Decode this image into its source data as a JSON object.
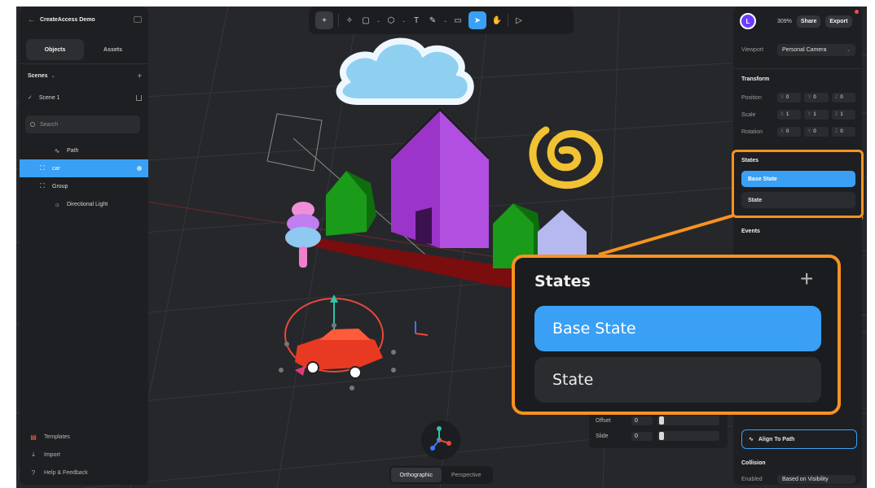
{
  "project": {
    "title": "CreateAccess Demo"
  },
  "left_panel": {
    "tabs": [
      {
        "label": "Objects"
      },
      {
        "label": "Assets"
      }
    ],
    "scenes_label": "Scenes",
    "scene_name": "Scene 1",
    "search_placeholder": "Search",
    "tree": [
      {
        "label": "Path",
        "icon": "path-icon"
      },
      {
        "label": "car",
        "icon": "group-icon",
        "selected": true
      },
      {
        "label": "Group",
        "icon": "group-icon"
      },
      {
        "label": "Directional Light",
        "icon": "light-icon"
      }
    ],
    "bottom": [
      {
        "label": "Templates",
        "icon": "templates-icon"
      },
      {
        "label": "Import",
        "icon": "import-icon"
      },
      {
        "label": "Help & Feedback",
        "icon": "help-icon"
      }
    ]
  },
  "toolbar": {
    "tools": [
      "add",
      "select-tools",
      "rectangle",
      "3d-shape",
      "text",
      "pen",
      "comment",
      "pointer",
      "hand",
      "play"
    ]
  },
  "right_panel": {
    "avatar_letter": "L",
    "zoom": "309%",
    "share_label": "Share",
    "export_label": "Export",
    "viewport_label": "Viewport",
    "viewport_value": "Personal Camera",
    "transform_label": "Transform",
    "position_label": "Position",
    "scale_label": "Scale",
    "rotation_label": "Rotation",
    "position": {
      "x": "0",
      "y": "0",
      "z": "0"
    },
    "scale": {
      "x": "1",
      "y": "1",
      "z": "1"
    },
    "rotation": {
      "x": "0",
      "y": "0",
      "z": "0"
    },
    "states_label": "States",
    "base_state_label": "Base State",
    "state_label": "State",
    "events_label": "Events",
    "align_to_path_label": "Align To Path",
    "collision_label": "Collision",
    "enabled_label": "Enabled",
    "enabled_value": "Based on Visibility"
  },
  "path_box": {
    "offset_label": "Offset",
    "offset_value": "0",
    "slide_label": "Slide",
    "slide_value": "0"
  },
  "callout": {
    "title": "States",
    "base_state_label": "Base State",
    "state_label": "State"
  },
  "view_toggle": {
    "orthographic": "Orthographic",
    "perspective": "Perspective"
  },
  "colors": {
    "accent": "#3aa0f5",
    "highlight": "#f7931e",
    "panel": "#1e1f22",
    "canvas": "#26272b"
  }
}
